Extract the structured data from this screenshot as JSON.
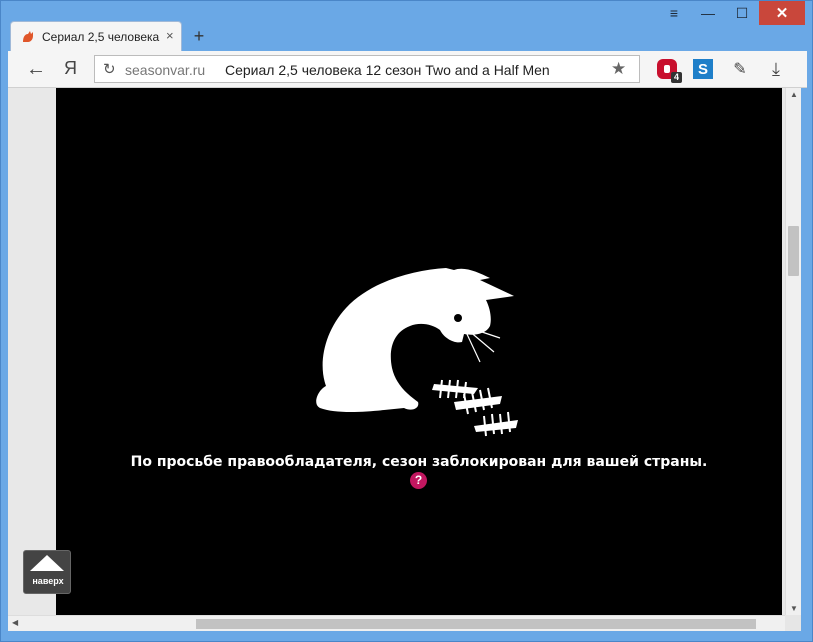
{
  "tab": {
    "title": "Сериал 2,5 человека",
    "favicon": "cat-icon",
    "close": "×"
  },
  "new_tab": "+",
  "window_buttons": {
    "menu": "≡",
    "minimize": "—",
    "maximize": "☐",
    "close": "✕"
  },
  "toolbar": {
    "back": "←",
    "yandex": "Я",
    "reload": "↻",
    "url_domain": "seasonvar.ru",
    "page_title": "Сериал 2,5 человека 12 сезон Two and a Half Men",
    "star": "★",
    "ext_adblock_badge": "4",
    "ext_s": "S",
    "dropper": "✎",
    "download": "⤓"
  },
  "player": {
    "message": "По просьбе правообладателя, сезон заблокирован для вашей страны.",
    "help": "?"
  },
  "to_top": {
    "label": "наверх"
  },
  "scroll": {
    "up": "▲",
    "down": "▼",
    "left": "◀",
    "right": "▶"
  }
}
